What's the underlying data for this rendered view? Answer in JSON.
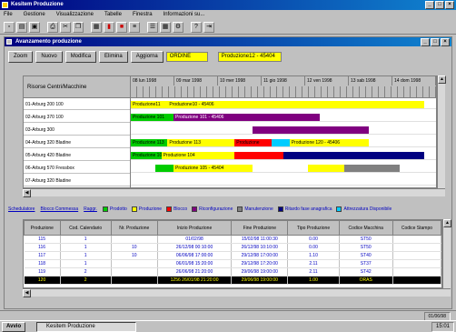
{
  "app": {
    "title": "Kesitem Produzione"
  },
  "menu": [
    "File",
    "Gestione",
    "Visualizzazione",
    "Tabelle",
    "Finestra",
    "Informazioni su..."
  ],
  "toolbar": [
    "new-icon",
    "open-icon",
    "save-icon",
    "print-icon",
    "cut-icon",
    "copy-icon",
    "paste-icon",
    "calendar-icon",
    "chart-icon",
    "stop-icon",
    "gantt-icon",
    "list-icon",
    "grid-icon",
    "settings-icon",
    "help-icon",
    "exit-icon"
  ],
  "window": {
    "title": "Avanzamento produzione",
    "buttons": [
      "Zoom",
      "Nuovo",
      "Modifica",
      "Elimina",
      "Aggiorna"
    ],
    "field1": "ORDINE",
    "field2": "Produzione12 - 45404"
  },
  "gantt": {
    "rows_title": "Risorse Centri/Macchine",
    "rows": [
      "01-Arburg 200 100",
      "02-Arburg 370 100",
      "03-Arburg 300",
      "04-Arburg 320 Bladine",
      "05-Arburg 420 Bladine",
      "06-Arburg 570 Fressbox",
      "07-Arburg 320 Bladine"
    ],
    "days": [
      "08 lun 1998",
      "09 mar 1998 ",
      "10 mer 1998",
      "11 gio 1998",
      "12 ven 1998",
      "13 sab 1998",
      "14 dom 1998"
    ],
    "bars": [
      {
        "row": 0,
        "start": 0.0,
        "end": 0.12,
        "color": "#ffff00",
        "label": "Produzione11"
      },
      {
        "row": 0,
        "start": 0.12,
        "end": 0.96,
        "color": "#ffff00",
        "label": "Produzione10 - 45406"
      },
      {
        "row": 1,
        "start": 0.0,
        "end": 0.14,
        "color": "#00cc00",
        "label": "Produzione 101"
      },
      {
        "row": 1,
        "start": 0.14,
        "end": 0.58,
        "color": "#800080",
        "label": "Produzione 101 - 45406"
      },
      {
        "row": 1,
        "start": 0.58,
        "end": 0.62,
        "color": "#800080",
        "label": ""
      },
      {
        "row": 2,
        "start": 0.4,
        "end": 0.78,
        "color": "#800080",
        "label": ""
      },
      {
        "row": 3,
        "start": 0.0,
        "end": 0.12,
        "color": "#00cc00",
        "label": "Produzione 113"
      },
      {
        "row": 3,
        "start": 0.12,
        "end": 0.34,
        "color": "#ffff00",
        "label": "Produzione 113"
      },
      {
        "row": 3,
        "start": 0.34,
        "end": 0.46,
        "color": "#ff0000",
        "label": "Produzione"
      },
      {
        "row": 3,
        "start": 0.46,
        "end": 0.52,
        "color": "#00ccff",
        "label": ""
      },
      {
        "row": 3,
        "start": 0.52,
        "end": 0.78,
        "color": "#ffff00",
        "label": "Produzione 120 - 45406"
      },
      {
        "row": 4,
        "start": 0.0,
        "end": 0.1,
        "color": "#00cc00",
        "label": "Produzione 103"
      },
      {
        "row": 4,
        "start": 0.1,
        "end": 0.34,
        "color": "#ffff00",
        "label": "Produzione 104"
      },
      {
        "row": 4,
        "start": 0.34,
        "end": 0.5,
        "color": "#ff0000",
        "label": ""
      },
      {
        "row": 4,
        "start": 0.5,
        "end": 0.96,
        "color": "#000080",
        "label": ""
      },
      {
        "row": 5,
        "start": 0.08,
        "end": 0.14,
        "color": "#00cc00",
        "label": ""
      },
      {
        "row": 5,
        "start": 0.14,
        "end": 0.4,
        "color": "#ffff00",
        "label": "Produzione 105 - 45404"
      },
      {
        "row": 5,
        "start": 0.58,
        "end": 0.7,
        "color": "#ffff00",
        "label": ""
      },
      {
        "row": 5,
        "start": 0.7,
        "end": 0.88,
        "color": "#808080",
        "label": ""
      }
    ]
  },
  "legend": {
    "tabs": [
      "Schedulatore",
      "Blocco Commessa",
      "Raggr."
    ],
    "items": [
      {
        "label": "Prodotto",
        "color": "#00cc00"
      },
      {
        "label": "Produzione",
        "color": "#ffff00"
      },
      {
        "label": "Blocco",
        "color": "#ff0000"
      },
      {
        "label": "Riconfigurazione",
        "color": "#800080"
      },
      {
        "label": "Manutenzione",
        "color": "#808080"
      },
      {
        "label": "Ritardo fase anagrafica",
        "color": "#000080"
      },
      {
        "label": "Attrezzatura Disponibile",
        "color": "#00ccff"
      }
    ]
  },
  "grid": {
    "headers": [
      "Produzione",
      "Cod. Calendario",
      "Nr. Produzione",
      "Inizio Produzione",
      "Fine Produzione",
      "Tipo Produzione",
      "Codice Macchina",
      "Codice Stampo"
    ],
    "rows": [
      [
        "115",
        "1",
        "",
        "01/02/98",
        "15/02/98 11:00:30",
        "0.00",
        "ST50",
        ""
      ],
      [
        "116",
        "1",
        "10",
        "26/12/98 00:10:00",
        "26/12/98 10:10:00",
        "0.00",
        "ST50",
        ""
      ],
      [
        "117",
        "1",
        "10",
        "06/06/98 17:00:00",
        "29/12/98 17:00:00",
        "1.10",
        "ST40",
        ""
      ],
      [
        "118",
        "1",
        "",
        "06/01/98 15:20:00",
        "29/12/98 17:20:00",
        "2.11",
        "ST37",
        ""
      ],
      [
        "119",
        "2",
        "",
        "26/06/98 21:20:00",
        "29/06/98 19:00:00",
        "2.11",
        "ST42",
        ""
      ],
      [
        "120",
        "2",
        "",
        "1256 26/01/98 21:20:00",
        "29/06/98 19:00:00",
        "1.00",
        "ORAS",
        ""
      ]
    ]
  },
  "status": {
    "right": "01/06/98"
  },
  "taskbar": {
    "start": "Avvio",
    "task": "Kesitem Produzione",
    "clock": "15:01"
  }
}
